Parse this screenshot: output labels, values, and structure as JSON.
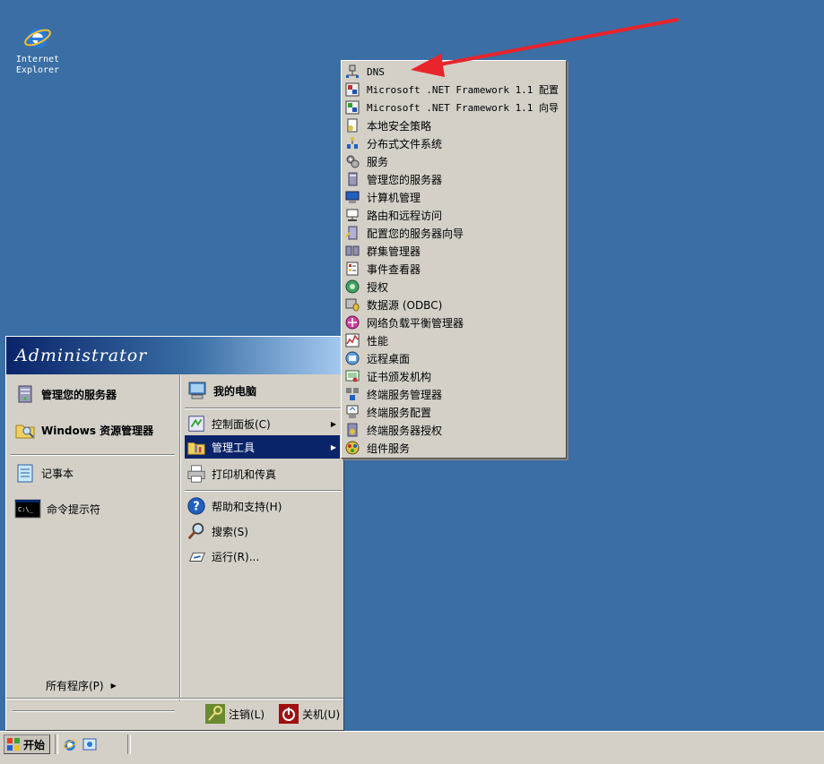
{
  "desktop": {
    "ie_icon": {
      "line1": "Internet",
      "line2": "Explorer",
      "icon": "internet-explorer-icon"
    }
  },
  "start_menu": {
    "user_name": "Administrator",
    "pinned": [
      {
        "label": "管理您的服务器",
        "icon": "server-manage-icon"
      },
      {
        "label": "Windows 资源管理器",
        "icon": "explorer-folder-icon"
      }
    ],
    "recent": [
      {
        "label": "记事本",
        "icon": "notepad-icon"
      },
      {
        "label": "命令提示符",
        "icon": "command-prompt-icon"
      }
    ],
    "all_programs": "所有程序(P)",
    "right": [
      {
        "label": "我的电脑",
        "icon": "my-computer-icon"
      },
      {
        "label": "控制面板(C)",
        "icon": "control-panel-icon"
      },
      {
        "label": "管理工具",
        "icon": "admin-tools-icon"
      },
      {
        "label": "打印机和传真",
        "icon": "printer-icon"
      },
      {
        "label": "帮助和支持(H)",
        "icon": "help-icon"
      },
      {
        "label": "搜索(S)",
        "icon": "search-icon"
      },
      {
        "label": "运行(R)...",
        "icon": "run-icon"
      }
    ],
    "logoff": "注销(L)",
    "shutdown": "关机(U)"
  },
  "admin_tools_submenu": {
    "items": [
      "DNS",
      "Microsoft .NET Framework 1.1 配置",
      "Microsoft .NET Framework 1.1 向导",
      "本地安全策略",
      "分布式文件系统",
      "服务",
      "管理您的服务器",
      "计算机管理",
      "路由和远程访问",
      "配置您的服务器向导",
      "群集管理器",
      "事件查看器",
      "授权",
      "数据源 (ODBC)",
      "网络负载平衡管理器",
      "性能",
      "远程桌面",
      "证书颁发机构",
      "终端服务管理器",
      "终端服务配置",
      "终端服务器授权",
      "组件服务"
    ]
  },
  "taskbar": {
    "start_label": "开始"
  },
  "colors": {
    "desktop": "#3a6ea5",
    "menu_bg": "#d4d0c8",
    "highlight": "#0a246a",
    "annotation_arrow": "#e8242c"
  }
}
